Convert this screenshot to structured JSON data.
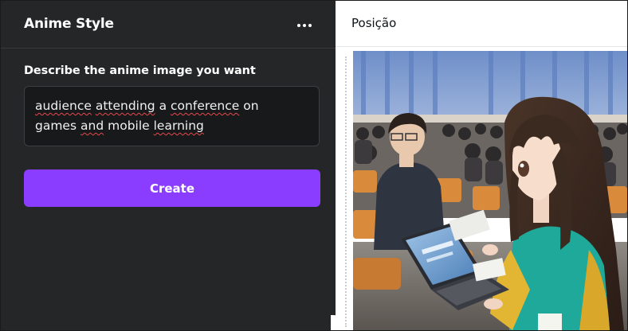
{
  "panel": {
    "title": "Anime Style",
    "more_icon": "more-horizontal-icon",
    "field_label": "Describe the anime image you want",
    "prompt": {
      "line1_words": [
        "audience",
        "attending",
        "a",
        "conference",
        "on"
      ],
      "line2_words": [
        "games",
        "and",
        "mobile",
        "learning"
      ],
      "misspelled": [
        "audience",
        "attending",
        "conference",
        "and",
        "learning"
      ]
    },
    "create_label": "Create"
  },
  "canvas": {
    "position_label": "Posição"
  },
  "colors": {
    "panel_bg": "#252627",
    "input_bg": "#18191b",
    "accent": "#8b3dff",
    "spellcheck": "#e5484d"
  }
}
